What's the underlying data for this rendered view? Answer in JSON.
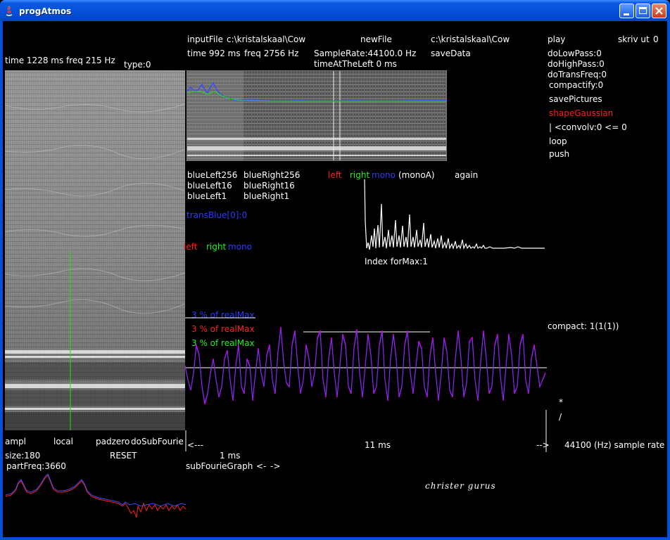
{
  "window": {
    "title": "progAtmos"
  },
  "left_panel": {
    "time": "time  1228 ms",
    "freq": "freq  215 Hz",
    "type": "type:0",
    "ampl": "ampl",
    "local": "local",
    "padzero": "padzero",
    "doSubFourie": "doSubFourie",
    "size": "size:180",
    "reset": "RESET",
    "partFreq": "partFreq:3660"
  },
  "top": {
    "inputFile": "inputFile",
    "inputPath": "c:\\kristalskaal\\Cow",
    "newFile": "newFile",
    "newPath": "c:\\kristalskaal\\Cow",
    "time": "time  992 ms",
    "freq": "freq  2756 Hz",
    "sampleRate": "SampleRate:44100.0 Hz",
    "timeAtTheLeft": "timeAtTheLeft  0 ms",
    "saveData": "saveData"
  },
  "right_menu": {
    "play": "play",
    "skriv_ut": "skriv ut",
    "skriv_val": "0",
    "doLowPass": "doLowPass:0",
    "doHighPass": "doHighPass:0",
    "doTransFreq": "doTransFreq:0",
    "compactify": "compactify:0",
    "savePictures": "savePictures",
    "shapeGaussian": "shapeGaussian",
    "convolv": "| <convolv:0 <= 0",
    "loop": "loop",
    "push": "push",
    "compact": "compact: 1(1(1))",
    "star": "*",
    "slash": "/"
  },
  "controls": {
    "blueLeft256": "blueLeft256",
    "blueRight256": "blueRight256",
    "blueLeft16": "blueLeft16",
    "blueRight16": "blueRight16",
    "blueLeft1": "blueLeft1",
    "blueRight1": "blueRight1",
    "left": "left",
    "right": "right",
    "mono": "mono",
    "monoA": "(monoA)",
    "again": "again",
    "transBlue": "transBlue[0]:0",
    "left2": "left",
    "right2": "right",
    "mono2": "mono",
    "indexForMax": "Index forMax:1"
  },
  "waveform": {
    "pct_blue": "3 % of realMax",
    "pct_red": "3 % of realMax",
    "pct_green": "3 % of realMax",
    "arrow_left": "<---",
    "duration": "11 ms",
    "arrow_right": "-->",
    "sample_rate": "44100 (Hz) sample rate",
    "one_ms": "1 ms",
    "subFourieGraph": "subFourieGraph",
    "nav_left": "<-",
    "nav_right": "->"
  },
  "signature": "christer   gurus",
  "colors": {
    "titlebar": "#0550d6",
    "background": "#000000",
    "red": "#ff2020",
    "green": "#22ee22",
    "blue": "#2a3cff",
    "magenta": "#e000e0"
  }
}
